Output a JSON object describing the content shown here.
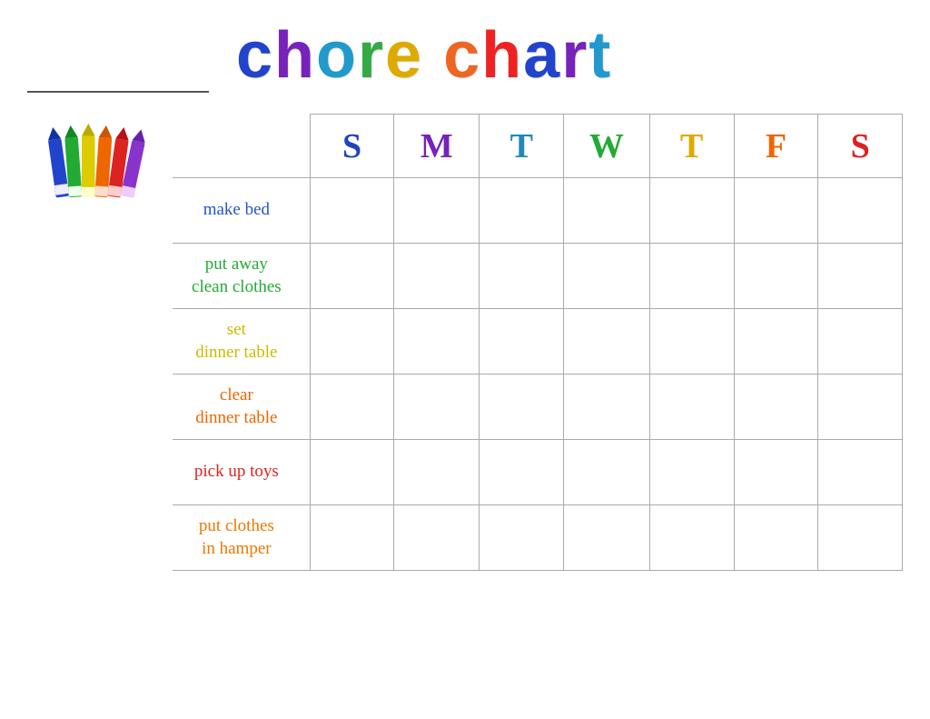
{
  "header": {
    "name_line_placeholder": "",
    "title": {
      "word1": "chore",
      "word2": "chart",
      "letters_word1": [
        "c",
        "h",
        "o",
        "r",
        "e"
      ],
      "letters_word2": [
        "c",
        "h",
        "a",
        "r",
        "t"
      ],
      "colors_word1": [
        "#2244cc",
        "#7722bb",
        "#2299cc",
        "#33aa44",
        "#ddaa00"
      ],
      "colors_word2": [
        "#ee6622",
        "#ee2222",
        "#2244cc",
        "#7722bb",
        "#2299cc"
      ]
    }
  },
  "days": {
    "headers": [
      "S",
      "M",
      "T",
      "W",
      "T",
      "F",
      "S"
    ],
    "colors": [
      "#2244bb",
      "#7722bb",
      "#2288bb",
      "#22aa33",
      "#ddaa00",
      "#ee6600",
      "#dd2222"
    ]
  },
  "chores": [
    {
      "id": "make-bed",
      "label": "make bed",
      "color": "#2255cc"
    },
    {
      "id": "put-away",
      "label": "put away\nclean clothes",
      "color": "#22aa33"
    },
    {
      "id": "set-dinner",
      "label": "set\ndinner table",
      "color": "#cccc00"
    },
    {
      "id": "clear-dinner",
      "label": "clear\ndinner table",
      "color": "#ee6600"
    },
    {
      "id": "pick-up-toys",
      "label": "pick up toys",
      "color": "#dd2222"
    },
    {
      "id": "put-clothes",
      "label": "put clothes\nin hamper",
      "color": "#ee7700"
    }
  ]
}
